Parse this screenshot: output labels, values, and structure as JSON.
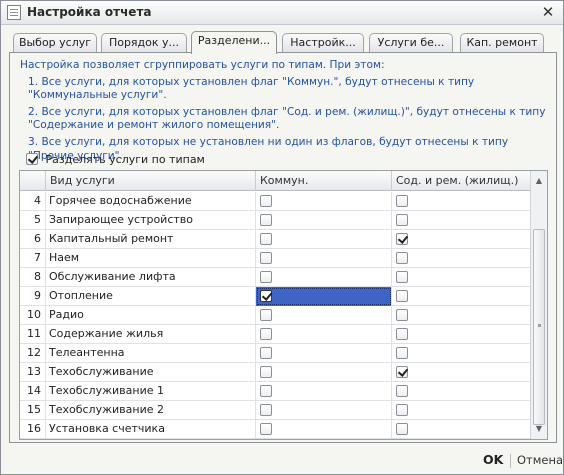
{
  "window": {
    "title": "Настройка отчета"
  },
  "tabs": [
    {
      "label": "Выбор услуг",
      "active": false
    },
    {
      "label": "Порядок у...",
      "active": false
    },
    {
      "label": "Разделени...",
      "active": true
    },
    {
      "label": "Настройк...",
      "active": false
    },
    {
      "label": "Услуги бе...",
      "active": false
    },
    {
      "label": "Кап. ремонт",
      "active": false
    }
  ],
  "info": {
    "line0": "Настройка позволяет сгруппировать услуги по типам. При этом:",
    "line1": "1. Все услуги, для которых установлен флаг \"Коммун.\", будут отнесены к типу \"Коммунальные услуги\".",
    "line2": "2. Все услуги, для которых установлен флаг \"Сод. и рем. (жилищ.)\", будут отнесены к типу \"Содержание и ремонт жилого помещения\".",
    "line3": "3. Все услуги, для которых не установлен ни один из флагов, будут отнесены к типу \"Прочие услуги\"."
  },
  "split_checkbox": {
    "label": "Разделять услуги по типам",
    "checked": true
  },
  "grid": {
    "columns": [
      "",
      "Вид услуги",
      "Коммун.",
      "Сод. и рем. (жилищ.)"
    ],
    "rows": [
      {
        "num": "4",
        "name": "Горячее водоснабжение",
        "comm": false,
        "soder": false
      },
      {
        "num": "5",
        "name": "Запирающее устройство",
        "comm": false,
        "soder": false
      },
      {
        "num": "6",
        "name": "Капитальный ремонт",
        "comm": false,
        "soder": true
      },
      {
        "num": "7",
        "name": "Наем",
        "comm": false,
        "soder": false
      },
      {
        "num": "8",
        "name": "Обслуживание лифта",
        "comm": false,
        "soder": false
      },
      {
        "num": "9",
        "name": "Отопление",
        "comm": true,
        "soder": false,
        "selected": "comm"
      },
      {
        "num": "10",
        "name": "Радио",
        "comm": false,
        "soder": false
      },
      {
        "num": "11",
        "name": "Содержание жилья",
        "comm": false,
        "soder": false
      },
      {
        "num": "12",
        "name": "Телеантенна",
        "comm": false,
        "soder": false
      },
      {
        "num": "13",
        "name": "Техобслуживание",
        "comm": false,
        "soder": true
      },
      {
        "num": "14",
        "name": "Техобслуживание 1",
        "comm": false,
        "soder": false
      },
      {
        "num": "15",
        "name": "Техобслуживание 2",
        "comm": false,
        "soder": false
      },
      {
        "num": "16",
        "name": "Установка счетчика",
        "comm": false,
        "soder": false
      }
    ]
  },
  "footer": {
    "ok_label": "OK",
    "cancel_label": "Отмена"
  },
  "colors": {
    "info_text": "#2452a0",
    "selection": "#3f64c8"
  }
}
